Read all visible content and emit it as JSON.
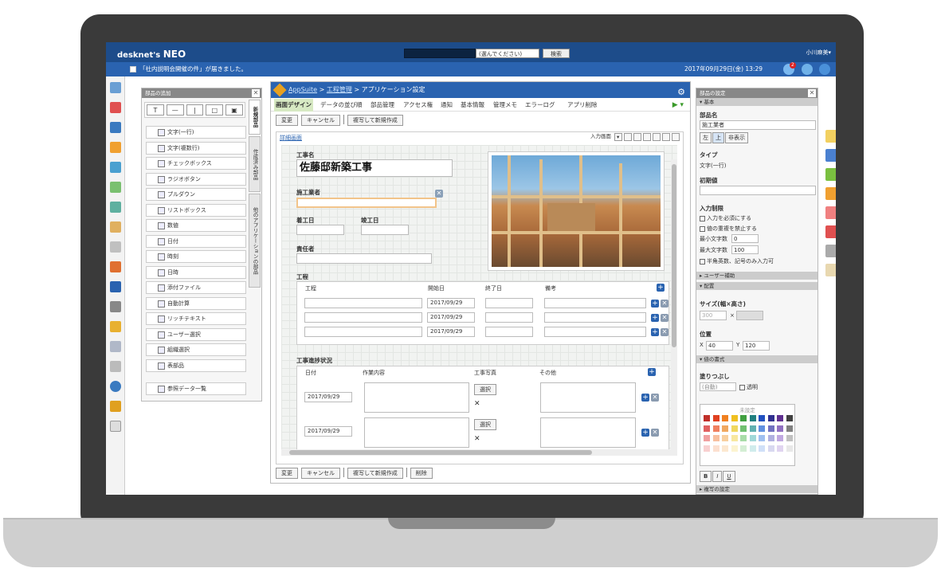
{
  "app": {
    "logo": "desknet's",
    "logo_bold": "NEO",
    "select_label": "(選んでください)",
    "search_label": "検索",
    "user_name": "小川麻美▾"
  },
  "notice": {
    "message": "「社内説明会開催の件」が届きました。",
    "datetime": "2017年09月29日(金) 13:29",
    "badge": "2"
  },
  "add_panel": {
    "title": "部品の追加",
    "close": "✕",
    "tools": [
      "T",
      "—",
      "|",
      "□",
      "▣"
    ],
    "items": [
      "文字(一行)",
      "文字(複数行)",
      "チェックボックス",
      "ラジオボタン",
      "プルダウン",
      "リストボックス",
      "数値",
      "日付",
      "時刻",
      "日時",
      "添付ファイル",
      "自動計算",
      "リッチテキスト",
      "ユーザー選択",
      "組織選択",
      "表部品",
      "参照データ一覧"
    ],
    "vtabs": [
      "新規部品",
      "作成済み部品",
      "他のアプリケーションの部品"
    ]
  },
  "main": {
    "breadcrumb": {
      "app": "AppSuite",
      "sep1": " > ",
      "module": "工程管理",
      "sep2": " > ",
      "page": "アプリケーション設定"
    },
    "tabs": [
      "画面デザイン",
      "データの並び順",
      "部品管理",
      "アクセス権",
      "通知",
      "基本情報",
      "管理メモ",
      "エラーログ",
      "アプリ削除"
    ],
    "actions": [
      "変更",
      "キャンセル",
      "複写して新規作成"
    ],
    "actions_bottom": [
      "変更",
      "キャンセル",
      "複写して新規作成",
      "削除"
    ],
    "detail_link": "詳細画面",
    "toolbar_label": "入力画面",
    "form": {
      "label_name": "工事名",
      "value_name": "佐藤邸新築工事",
      "label_contractor": "施工業者",
      "label_start": "着工日",
      "label_end": "竣工日",
      "label_manager": "責任者",
      "label_process": "工程",
      "process_headers": [
        "工程",
        "開始日",
        "終了日",
        "備考"
      ],
      "process_rows": [
        {
          "start": "2017/09/29"
        },
        {
          "start": "2017/09/29"
        },
        {
          "start": "2017/09/29"
        }
      ],
      "label_progress": "工事進捗状況",
      "progress_headers": [
        "日付",
        "作業内容",
        "工事写真",
        "その他"
      ],
      "progress_rows": [
        {
          "date": "2017/09/29",
          "select": "選択"
        },
        {
          "date": "2017/09/29",
          "select": "選択"
        }
      ]
    }
  },
  "settings": {
    "title": "部品の設定",
    "sec_basic": "▾ 基本",
    "label_partname": "部品名",
    "value_partname": "施工業者",
    "align": [
      "左",
      "上",
      "非表示"
    ],
    "label_type": "タイプ",
    "value_type": "文字(一行)",
    "label_initial": "初期値",
    "label_limit": "入力制限",
    "limit_required": "入力を必須にする",
    "limit_dup": "値の重複を禁止する",
    "label_min": "最小文字数",
    "value_min": "0",
    "label_max": "最大文字数",
    "value_max": "100",
    "limit_alnum": "半角英数、記号のみ入力可",
    "sec_user": "▸ ユーザー補助",
    "sec_layout": "▾ 配置",
    "label_size": "サイズ(幅×高さ)",
    "value_width": "300",
    "times": "×",
    "label_pos": "位置",
    "pos_x_label": "X",
    "pos_x": "40",
    "pos_y_label": "Y",
    "pos_y": "120",
    "sec_format": "▾ 値の書式",
    "label_fill": "塗りつぶし",
    "value_fill": "(自動)",
    "transparent": "透明",
    "unset": "未設定",
    "font_buttons": [
      "B",
      "I",
      "U"
    ],
    "sec_copy": "▸ 複写の設定"
  },
  "colors": {
    "primary": "#2a63b0",
    "header": "#1d4c8a",
    "active_tab": "#d7e9c3"
  }
}
